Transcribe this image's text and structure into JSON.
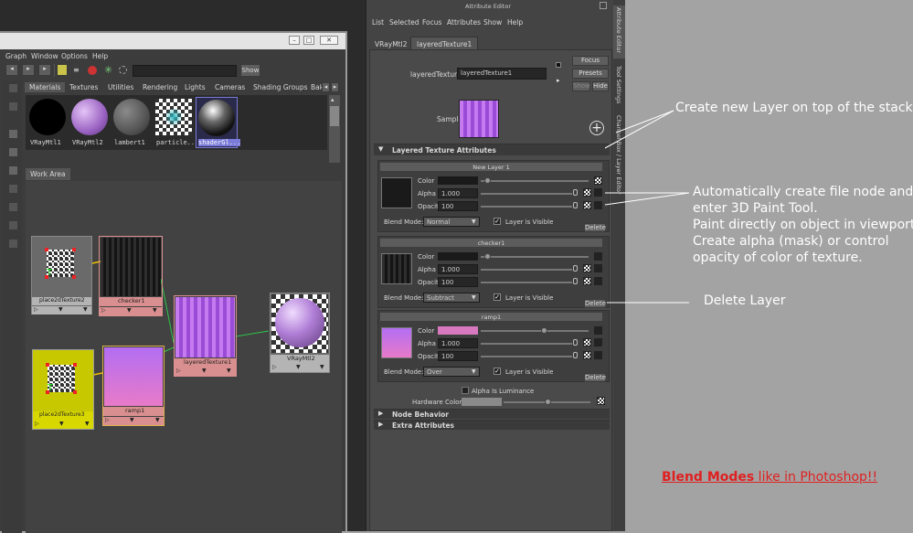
{
  "hypershade": {
    "menu": [
      "Graph",
      "Window",
      "Options",
      "Help"
    ],
    "show_button": "Show",
    "tabs": [
      "Materials",
      "Textures",
      "Utilities",
      "Rendering",
      "Lights",
      "Cameras",
      "Shading Groups",
      "Bak"
    ],
    "swatches": [
      "VRayMtl1",
      "VRayMtl2",
      "lambert1",
      "particle...",
      "shaderGl..."
    ],
    "work_area_tab": "Work Area",
    "nodes": {
      "place2d_a": "place2dTexture2",
      "checker": "checker1",
      "layered": "layeredTexture1",
      "vraymtl": "VRayMtl2",
      "place2d_b": "place2dTexture3",
      "ramp": "ramp1"
    }
  },
  "attribute_editor": {
    "title": "Attribute Editor",
    "menu": [
      "List",
      "Selected",
      "Focus",
      "Attributes",
      "Show",
      "Help"
    ],
    "tabs": [
      "VRayMtl2",
      "layeredTexture1"
    ],
    "type_label": "layeredTexture:",
    "name_value": "layeredTexture1",
    "buttons": {
      "focus": "Focus",
      "presets": "Presets",
      "show": "Show",
      "hide": "Hide"
    },
    "sample_label": "Sample",
    "section_title": "Layered Texture Attributes",
    "layers": [
      {
        "name": "New Layer 1",
        "alpha": "1.000",
        "opacity": "100",
        "blend_mode": "Normal"
      },
      {
        "name": "checker1",
        "alpha": "1.000",
        "opacity": "100",
        "blend_mode": "Subtract"
      },
      {
        "name": "ramp1",
        "alpha": "1.000",
        "opacity": "100",
        "blend_mode": "Over"
      }
    ],
    "labels": {
      "color": "Color",
      "alpha": "Alpha",
      "opacity": "Opacity",
      "blend_mode": "Blend Mode:",
      "layer_visible": "Layer is Visible",
      "delete": "Delete"
    },
    "alpha_is_luminance": "Alpha Is Luminance",
    "hardware_color": "Hardware Color",
    "node_behavior": "Node Behavior",
    "extra_attributes": "Extra Attributes"
  },
  "side_tabs": [
    "Attribute Editor",
    "Tool Settings",
    "Channel Box / Layer Editor"
  ],
  "annotations": {
    "create_layer": "Create new Layer on top of the stack",
    "auto_file": [
      "Automatically create file node and",
      "enter 3D Paint Tool.",
      "Paint directly on object in viewport.",
      "Create alpha (mask) or control",
      "opacity of color of texture."
    ],
    "delete_layer": "Delete Layer",
    "blend_modes_highlight": "Blend Modes",
    "blend_modes_rest": " like in Photoshop!! "
  },
  "colors": {
    "blend_modes_note": "#e02020",
    "layer_color_new": "#1a1a1a",
    "layer_color_checker": "#1a1a1a",
    "layer_color_ramp": "#d879c0",
    "node_bar": "#d98f8f",
    "place2d_b_bg": "#c8c800"
  }
}
